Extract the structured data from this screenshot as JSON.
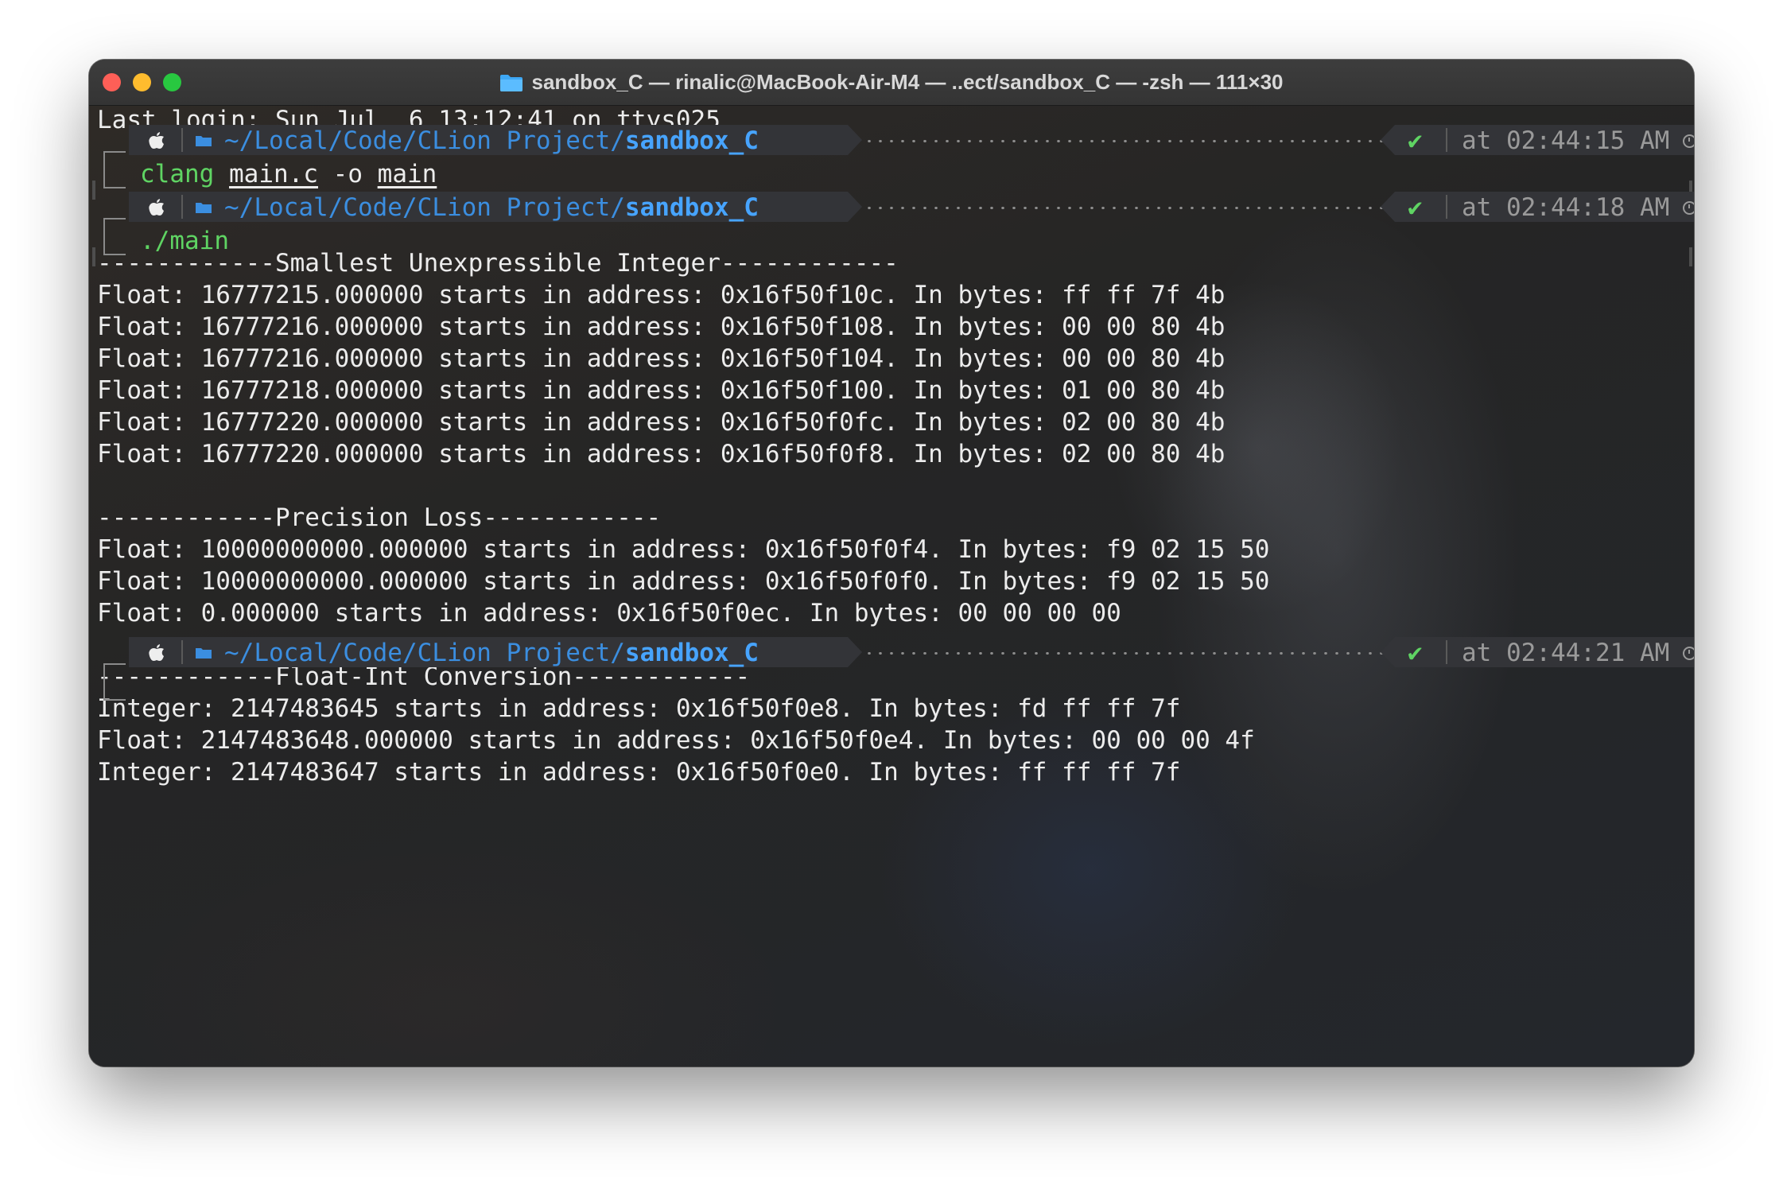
{
  "window": {
    "title": "sandbox_C — rinalic@MacBook-Air-M4 — ..ect/sandbox_C — -zsh — 111×30",
    "title_icon": "folder-icon",
    "traffic_lights": [
      "close",
      "minimize",
      "zoom"
    ],
    "colors": {
      "close": "#fe5f57",
      "minimize": "#febc2e",
      "zoom": "#28c840"
    }
  },
  "terminal": {
    "last_login": "Last login: Sun Jul  6 13:12:41 on ttys025",
    "prompts": [
      {
        "apple": "apple-icon",
        "path_prefix": "~/Local/Code/CLion Project/",
        "path_dir": "sandbox_C",
        "status": "✔",
        "time": "at 02:44:15 AM"
      },
      {
        "apple": "apple-icon",
        "path_prefix": "~/Local/Code/CLion Project/",
        "path_dir": "sandbox_C",
        "status": "✔",
        "time": "at 02:44:18 AM"
      },
      {
        "apple": "apple-icon",
        "path_prefix": "~/Local/Code/CLion Project/",
        "path_dir": "sandbox_C",
        "status": "✔",
        "time": "at 02:44:21 AM"
      }
    ],
    "command1": {
      "name": "clang",
      "arg1": "main.c",
      "flag": "-o",
      "arg2": "main"
    },
    "command2": {
      "name": "./main"
    },
    "output": [
      "------------Smallest Unexpressible Integer------------",
      "Float: 16777215.000000 starts in address: 0x16f50f10c. In bytes: ff ff 7f 4b",
      "Float: 16777216.000000 starts in address: 0x16f50f108. In bytes: 00 00 80 4b",
      "Float: 16777216.000000 starts in address: 0x16f50f104. In bytes: 00 00 80 4b",
      "Float: 16777218.000000 starts in address: 0x16f50f100. In bytes: 01 00 80 4b",
      "Float: 16777220.000000 starts in address: 0x16f50f0fc. In bytes: 02 00 80 4b",
      "Float: 16777220.000000 starts in address: 0x16f50f0f8. In bytes: 02 00 80 4b",
      "",
      "------------Precision Loss------------",
      "Float: 10000000000.000000 starts in address: 0x16f50f0f4. In bytes: f9 02 15 50",
      "Float: 10000000000.000000 starts in address: 0x16f50f0f0. In bytes: f9 02 15 50",
      "Float: 0.000000 starts in address: 0x16f50f0ec. In bytes: 00 00 00 00",
      "",
      "------------Float-Int Conversion------------",
      "Integer: 2147483645 starts in address: 0x16f50f0e8. In bytes: fd ff ff 7f",
      "Float: 2147483648.000000 starts in address: 0x16f50f0e4. In bytes: 00 00 00 4f",
      "Integer: 2147483647 starts in address: 0x16f50f0e0. In bytes: ff ff ff 7f"
    ]
  }
}
